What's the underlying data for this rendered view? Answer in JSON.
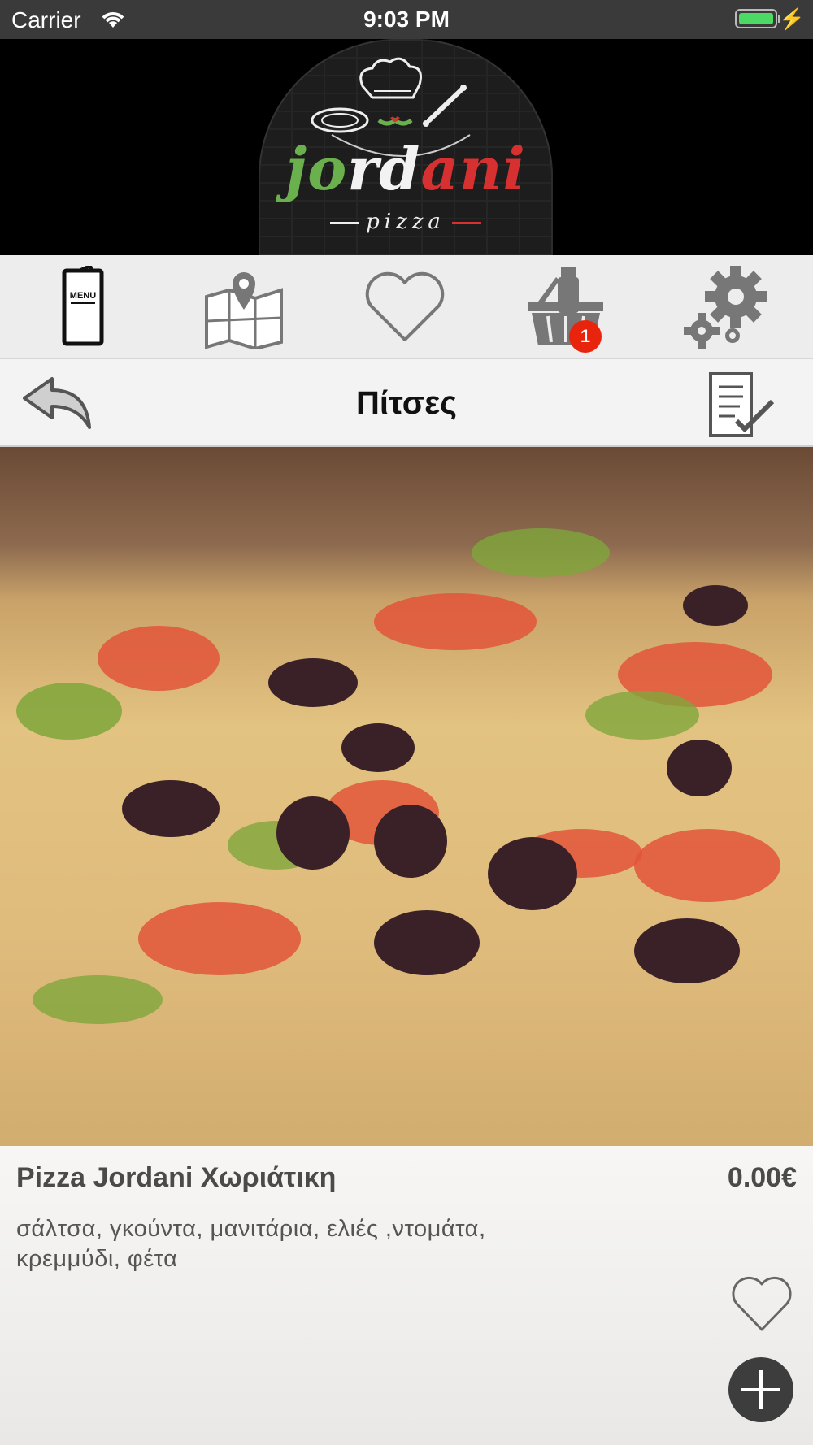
{
  "status_bar": {
    "carrier": "Carrier",
    "time": "9:03 PM"
  },
  "header": {
    "logo_text": "jordani",
    "logo_subtext": "pizza"
  },
  "nav": {
    "items": [
      {
        "icon": "menu-icon",
        "label": "MENU"
      },
      {
        "icon": "map-icon"
      },
      {
        "icon": "heart-icon"
      },
      {
        "icon": "basket-icon"
      },
      {
        "icon": "gears-icon"
      }
    ],
    "cart_badge": "1"
  },
  "page": {
    "title": "Πίτσες"
  },
  "product": {
    "name": "Pizza Jordani Χωριάτικη",
    "price": "0.00€",
    "description": "σάλτσα, γκούντα, μανιτάρια, ελιές ,ντομάτα, κρεμμύδι, φέτα"
  },
  "colors": {
    "badge": "#e8240d",
    "logo_green": "#6ab04c",
    "logo_red": "#d63031",
    "add_button": "#3d3d3d"
  }
}
